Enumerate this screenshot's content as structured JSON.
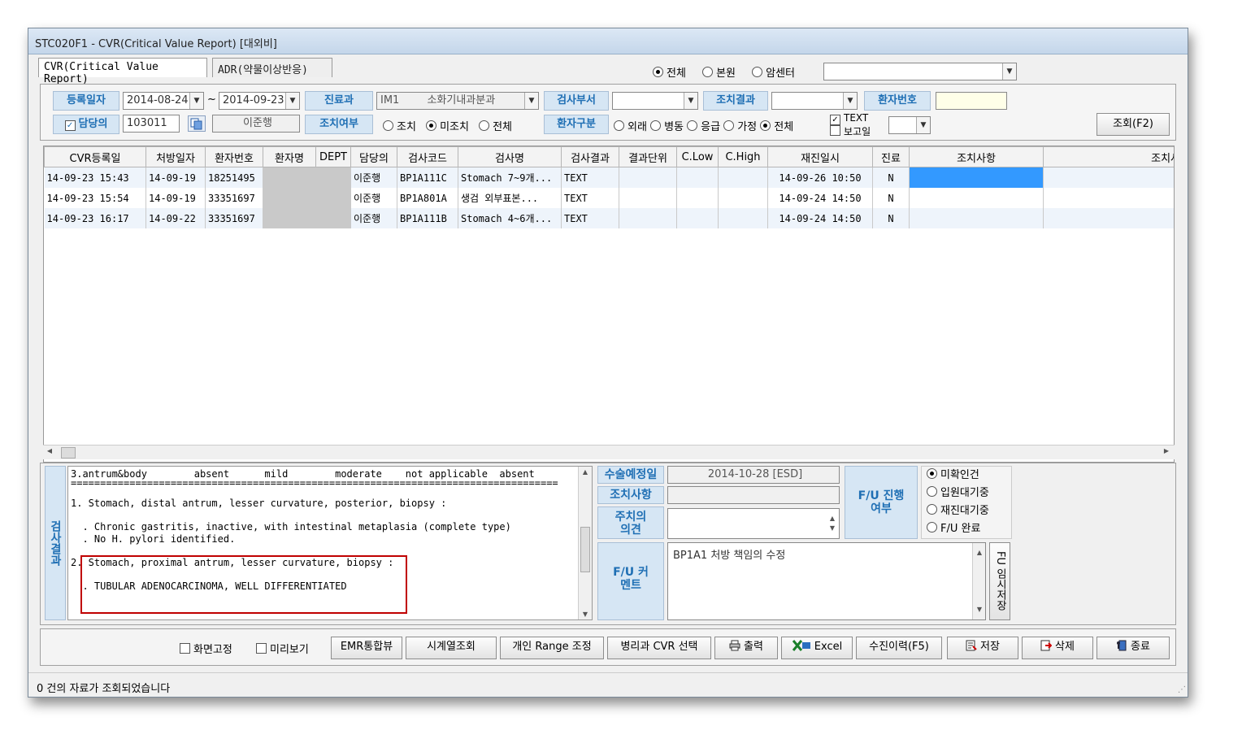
{
  "window": {
    "title": "STC020F1 - CVR(Critical Value Report) [대외비]"
  },
  "tabs": [
    {
      "label": "CVR(Critical Value Report)"
    },
    {
      "label": "ADR(약물이상반응)"
    }
  ],
  "scope": {
    "options": [
      "전체",
      "본원",
      "암센터"
    ],
    "selected": "전체",
    "center_value": ""
  },
  "filters": {
    "reg_date_label": "등록일자",
    "date_from": "2014-08-24",
    "date_sep": "~",
    "date_to": "2014-09-23",
    "dept_label": "진료과",
    "dept_code": "IM1",
    "dept_name": "소화기내과분과",
    "exam_dept_label": "검사부서",
    "exam_dept_value": "",
    "action_result_label": "조치결과",
    "action_result_value": "",
    "patient_no_label": "환자번호",
    "patient_no_value": "",
    "doctor_label": "담당의",
    "doctor_checked": true,
    "doctor_id": "103011",
    "doctor_name": "이준행",
    "action_status_label": "조치여부",
    "action_status_options": [
      "조치",
      "미조치",
      "전체"
    ],
    "action_status_selected": "미조치",
    "patient_type_label": "환자구분",
    "patient_type_options": [
      "외래",
      "병동",
      "응급",
      "가정",
      "전체"
    ],
    "patient_type_selected": "전체",
    "text_check_label": "TEXT",
    "report_date_label": "보고일",
    "report_date_value": "",
    "search_button": "조회(F2)"
  },
  "grid": {
    "columns": [
      "CVR등록일",
      "처방일자",
      "환자번호",
      "환자명",
      "DEPT",
      "담당의",
      "검사코드",
      "검사명",
      "검사결과",
      "결과단위",
      "C.Low",
      "C.High",
      "재진일시",
      "진료",
      "조치사항",
      "조치사항 코멘트"
    ],
    "rows": [
      {
        "reg": "14-09-23 15:43",
        "rx": "14-09-19",
        "pt": "18251495",
        "name": "",
        "dept": "",
        "doc": "이준행",
        "code": "BP1A111C",
        "exam": "Stomach 7~9개...",
        "result": "TEXT",
        "unit": "",
        "low": "",
        "high": "",
        "revisit": "14-09-26 10:50",
        "care": "N",
        "action": "",
        "comment": ""
      },
      {
        "reg": "14-09-23 15:54",
        "rx": "14-09-19",
        "pt": "33351697",
        "name": "",
        "dept": "",
        "doc": "이준행",
        "code": "BP1A801A",
        "exam": "생검 외부표본...",
        "result": "TEXT",
        "unit": "",
        "low": "",
        "high": "",
        "revisit": "14-09-24 14:50",
        "care": "N",
        "action": "",
        "comment": ""
      },
      {
        "reg": "14-09-23 16:17",
        "rx": "14-09-22",
        "pt": "33351697",
        "name": "",
        "dept": "",
        "doc": "이준행",
        "code": "BP1A111B",
        "exam": "Stomach 4~6개...",
        "result": "TEXT",
        "unit": "",
        "low": "",
        "high": "",
        "revisit": "14-09-24 14:50",
        "care": "N",
        "action": "",
        "comment": ""
      }
    ]
  },
  "result": {
    "label": "검사결과",
    "lines": [
      "3.antrum&body        absent      mild        moderate    not applicable  absent",
      "======================================================================================",
      "1. Stomach, distal antrum, lesser curvature, posterior, biopsy :",
      "  . Chronic gastritis, inactive, with intestinal metaplasia (complete type)",
      "  . No H. pylori identified.",
      "2. Stomach, proximal antrum, lesser curvature, biopsy :",
      "  . TUBULAR ADENOCARCINOMA, WELL DIFFERENTIATED"
    ],
    "highlight_color": "#c00000"
  },
  "details": {
    "surgery_date_label": "수술예정일",
    "surgery_date_value": "2014-10-28 [ESD]",
    "action_label": "조치사항",
    "action_value": "",
    "doctor_opinion_label": "주치의 의견",
    "doctor_opinion_value": "",
    "fu_comment_label": "F/U 커멘트",
    "fu_comment_value": "BP1A1 처방 책임의 수정",
    "fu_progress_label": "F/U 진행여부",
    "fu_options": [
      "미확인건",
      "입원대기중",
      "재진대기중",
      "F/U 완료"
    ],
    "fu_selected": "미확인건",
    "fu_temp_save_label": "FU 임시저장"
  },
  "toolbar": {
    "fix_screen": "화면고정",
    "preview": "미리보기",
    "buttons": [
      "EMR통합뷰",
      "시계열조회",
      "개인 Range 조정",
      "병리과 CVR 선택",
      "출력",
      "Excel",
      "수진이력(F5)",
      "저장",
      "삭제",
      "종료"
    ]
  },
  "status": {
    "text": "0 건의 자료가 조회되었습니다"
  },
  "colors": {
    "label_bg": "#d6e6f4",
    "label_text": "#1f6fb4",
    "selection": "#3399ff",
    "odd_row": "#eef4fb"
  }
}
